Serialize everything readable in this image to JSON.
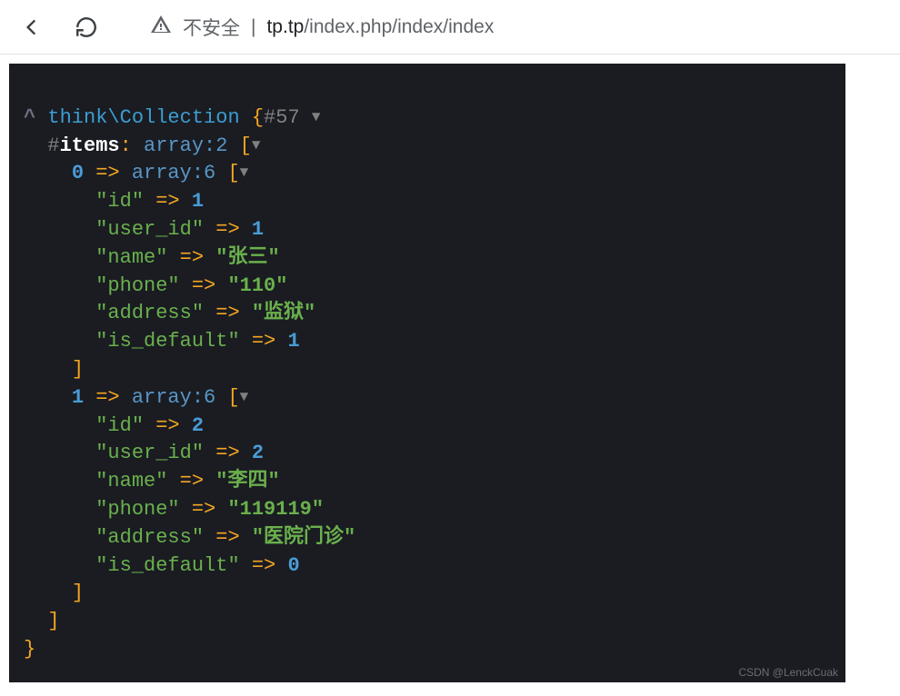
{
  "browser": {
    "insecure_label": "不安全",
    "url_host": "tp.tp",
    "url_path": "/index.php/index/index"
  },
  "dump": {
    "caret": "^",
    "class_name": "think\\Collection",
    "object_id": "#57",
    "items_label": "items",
    "items_type": "array:2",
    "entries": [
      {
        "index": "0",
        "type": "array:6",
        "fields": {
          "id": {
            "key": "\"id\"",
            "value": "1",
            "is_string": false
          },
          "user_id": {
            "key": "\"user_id\"",
            "value": "1",
            "is_string": false
          },
          "name": {
            "key": "\"name\"",
            "value": "\"张三\"",
            "is_string": true
          },
          "phone": {
            "key": "\"phone\"",
            "value": "\"110\"",
            "is_string": true
          },
          "address": {
            "key": "\"address\"",
            "value": "\"监狱\"",
            "is_string": true
          },
          "is_default": {
            "key": "\"is_default\"",
            "value": "1",
            "is_string": false
          }
        }
      },
      {
        "index": "1",
        "type": "array:6",
        "fields": {
          "id": {
            "key": "\"id\"",
            "value": "2",
            "is_string": false
          },
          "user_id": {
            "key": "\"user_id\"",
            "value": "2",
            "is_string": false
          },
          "name": {
            "key": "\"name\"",
            "value": "\"李四\"",
            "is_string": true
          },
          "phone": {
            "key": "\"phone\"",
            "value": "\"119119\"",
            "is_string": true
          },
          "address": {
            "key": "\"address\"",
            "value": "\"医院门诊\"",
            "is_string": true
          },
          "is_default": {
            "key": "\"is_default\"",
            "value": "0",
            "is_string": false
          }
        }
      }
    ]
  },
  "watermark": "CSDN @LenckCuak"
}
